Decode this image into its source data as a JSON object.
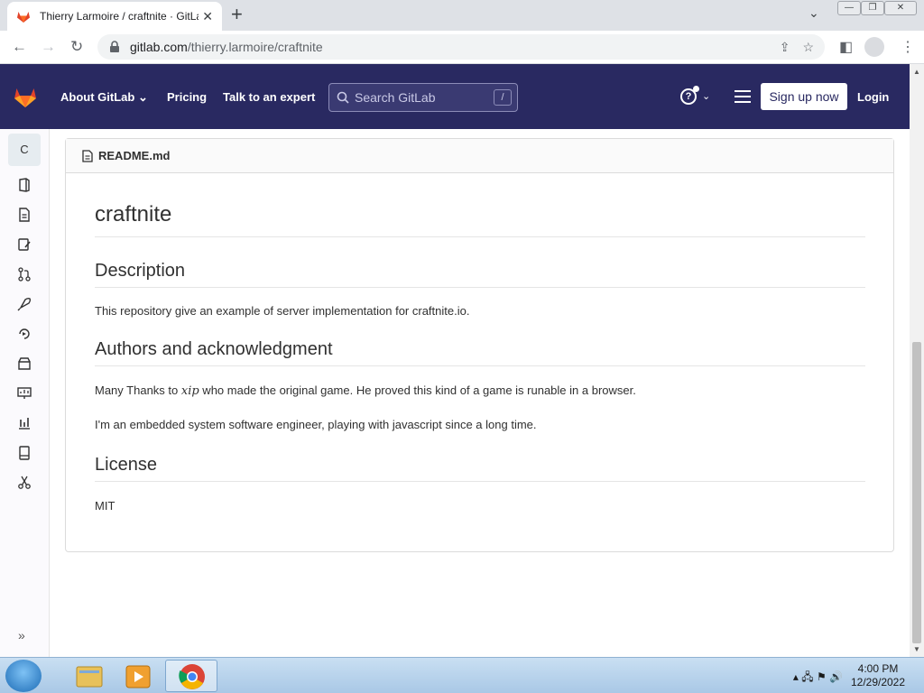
{
  "browser": {
    "tab_title": "Thierry Larmoire / craftnite · GitLab",
    "tab_close_icon": "close-icon",
    "url_host": "gitlab.com",
    "url_path": "/thierry.larmoire/craftnite"
  },
  "gitlab_header": {
    "about": "About GitLab",
    "pricing": "Pricing",
    "talk": "Talk to an expert",
    "search_placeholder": "Search GitLab",
    "search_shortcut": "/",
    "signup": "Sign up now",
    "login": "Login",
    "brand_color": "#292961"
  },
  "sidebar": {
    "project_letter": "C",
    "items": [
      {
        "icon": "project-overview-icon"
      },
      {
        "icon": "repository-icon"
      },
      {
        "icon": "issues-icon"
      },
      {
        "icon": "merge-requests-icon"
      },
      {
        "icon": "ci-cd-icon"
      },
      {
        "icon": "deployments-icon"
      },
      {
        "icon": "packages-icon"
      },
      {
        "icon": "monitor-icon"
      },
      {
        "icon": "analytics-icon"
      },
      {
        "icon": "wiki-icon"
      },
      {
        "icon": "snippets-icon"
      }
    ]
  },
  "readme": {
    "filename": "README.md",
    "title": "craftnite",
    "h_description": "Description",
    "description": "This repository give an example of server implementation for craftnite.io.",
    "h_authors": "Authors and acknowledgment",
    "authors_p1_pre": "Many Thanks to ",
    "authors_p1_name": "xip",
    "authors_p1_post": " who made the original game. He proved this kind of a game is runable in a browser.",
    "authors_p2": "I'm an embedded system software engineer, playing with javascript since a long time.",
    "h_license": "License",
    "license": "MIT"
  },
  "taskbar": {
    "time": "4:00 PM",
    "date": "12/29/2022"
  }
}
